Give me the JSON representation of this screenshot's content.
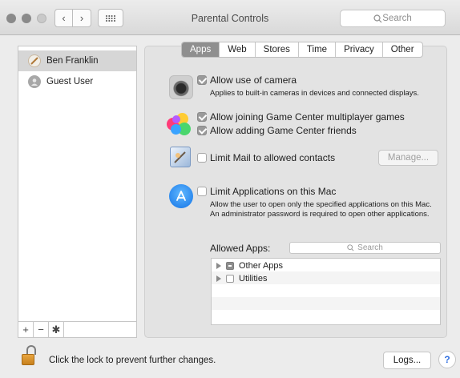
{
  "window": {
    "title": "Parental Controls"
  },
  "toolbar": {
    "search_placeholder": "Search",
    "back": "‹",
    "forward": "›",
    "grid": "⠿"
  },
  "sidebar": {
    "users": [
      {
        "name": "Ben Franklin",
        "selected": true
      },
      {
        "name": "Guest User",
        "selected": false
      }
    ],
    "tools": {
      "add": "+",
      "remove": "−",
      "settings": "✱"
    }
  },
  "tabs": [
    {
      "label": "Apps",
      "active": true
    },
    {
      "label": "Web",
      "active": false
    },
    {
      "label": "Stores",
      "active": false
    },
    {
      "label": "Time",
      "active": false
    },
    {
      "label": "Privacy",
      "active": false
    },
    {
      "label": "Other",
      "active": false
    }
  ],
  "apps": {
    "camera": {
      "label": "Allow use of camera",
      "checked": true,
      "description": "Applies to built-in cameras in devices and connected displays."
    },
    "gamecenter_multiplayer": {
      "label": "Allow joining Game Center multiplayer games",
      "checked": true
    },
    "gamecenter_friends": {
      "label": "Allow adding Game Center friends",
      "checked": true
    },
    "mail": {
      "label": "Limit Mail to allowed contacts",
      "checked": false,
      "manage_label": "Manage..."
    },
    "limit_apps": {
      "label": "Limit Applications on this Mac",
      "checked": false,
      "description": "Allow the user to open only the specified applications on this Mac. An administrator password is required to open other applications."
    },
    "allowed_apps": {
      "label": "Allowed Apps:",
      "search_placeholder": "Search",
      "items": [
        {
          "name": "Other Apps",
          "state": "mixed"
        },
        {
          "name": "Utilities",
          "state": "unchecked"
        }
      ]
    }
  },
  "footer": {
    "lock_text": "Click the lock to prevent further changes.",
    "logs_label": "Logs...",
    "help_label": "?"
  },
  "colors": {
    "selected_row": "#d6d6d6",
    "active_tab": "#8f8f8f",
    "help_accent": "#2f6fe0",
    "lock": "#e0962e"
  }
}
